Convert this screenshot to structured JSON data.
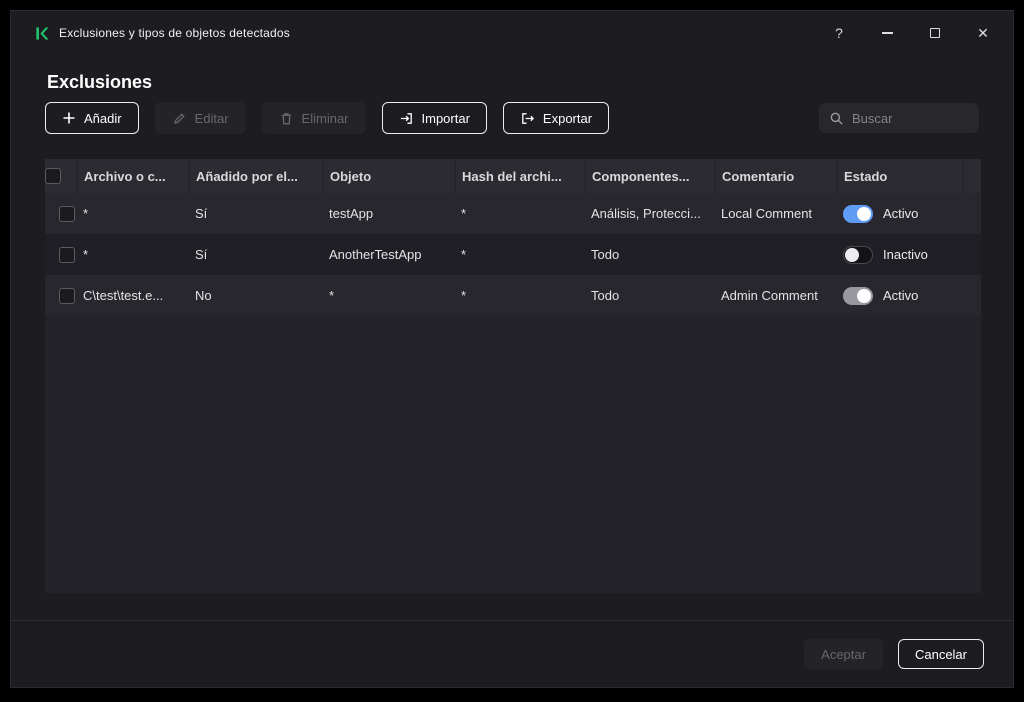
{
  "window": {
    "title": "Exclusiones y tipos de objetos detectados",
    "help": "?",
    "close": "✕"
  },
  "page": {
    "title": "Exclusiones"
  },
  "toolbar": {
    "add": "Añadir",
    "edit": "Editar",
    "remove": "Eliminar",
    "import": "Importar",
    "export": "Exportar",
    "search_placeholder": "Buscar"
  },
  "table": {
    "columns": [
      "Archivo o c...",
      "Añadido por el...",
      "Objeto",
      "Hash del archi...",
      "Componentes...",
      "Comentario",
      "Estado"
    ],
    "rows": [
      {
        "file": "*",
        "added": "Sí",
        "object": "testApp",
        "hash": "*",
        "components": "Análisis, Protecci...",
        "comment": "Local Comment",
        "status": "Activo"
      },
      {
        "file": "*",
        "added": "Sí",
        "object": "AnotherTestApp",
        "hash": "*",
        "components": "Todo",
        "comment": "",
        "status": "Inactivo"
      },
      {
        "file": "C\\test\\test.e...",
        "added": "No",
        "object": "*",
        "hash": "*",
        "components": "Todo",
        "comment": "Admin Comment",
        "status": "Activo"
      }
    ]
  },
  "footer": {
    "accept": "Aceptar",
    "cancel": "Cancelar"
  },
  "colors": {
    "brand_green": "#23C16B",
    "toggle_blue": "#5e9cf5"
  }
}
